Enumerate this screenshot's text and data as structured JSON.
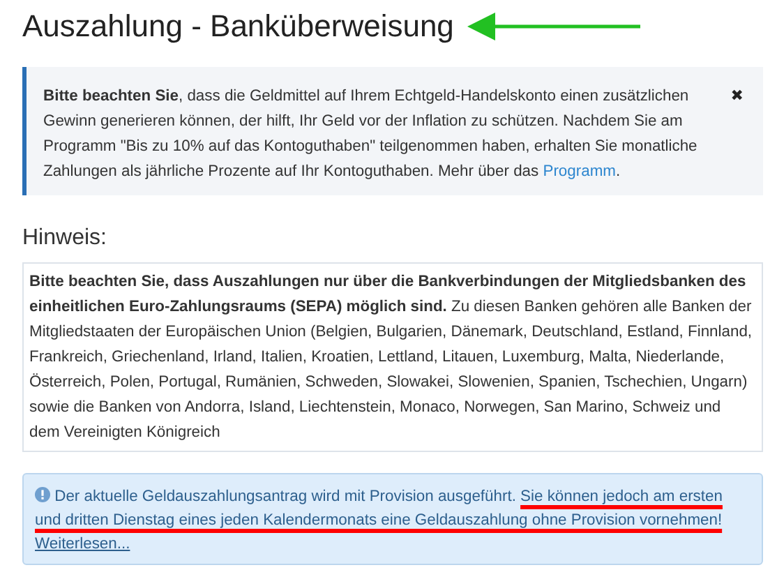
{
  "title": "Auszahlung - Banküberweisung",
  "info_box": {
    "text": "**Bitte beachten Sie**, dass die Geldmittel auf Ihrem Echtgeld-Handelskonto einen zusätzlichen Gewinn generieren können, der hilft, Ihr Geld vor der Inflation zu schützen. Nachdem Sie am Programm \"Bis zu 10% auf das Kontoguthaben\" teilgenommen haben, erhalten Sie monatliche Zahlungen als jährliche Prozente auf Ihr Kontoguthaben. Mehr über das",
    "link": "Programm",
    "link_end": ".",
    "close": "✖"
  },
  "hint": {
    "heading": "Hinweis:",
    "text": "**Bitte beachten Sie, dass Auszahlungen nur über die Bankverbindungen der Mitgliedsbanken des einheitlichen Euro-Zahlungsraums (SEPA) möglich sind.** Zu diesen Banken gehören alle Banken der Mitgliedstaaten der Europäischen Union (Belgien, Bulgarien, Dänemark, Deutschland, Estland, Finnland, Frankreich, Griechenland, Irland, Italien, Kroatien, Lettland, Litauen, Luxemburg, Malta, Niederlande, Österreich, Polen, Portugal, Rumänien, Schweden, Slowakei, Slowenien, Spanien, Tschechien, Ungarn) sowie die Banken von Andorra, Island, Liechtenstein, Monaco, Norwegen, San Marino, Schweiz und dem Vereinigten Königreich"
  },
  "notice": {
    "text": "Der aktuelle Geldauszahlungsantrag wird mit Provision ausgeführt.",
    "highlight": "Sie können jedoch am ersten und dritten Dienstag eines jeden Kalendermonats eine Geldauszahlung ohne Provision vornehmen!",
    "link": "Weiterlesen..."
  }
}
